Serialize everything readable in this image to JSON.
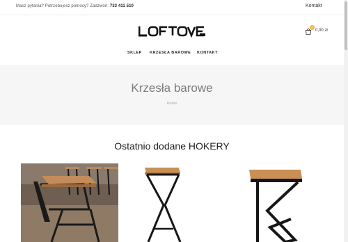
{
  "topbar": {
    "question": "Masz pytania? Potrzebujesz pomocy? Zadzwoń:",
    "phone": "733 411 510",
    "contact_link": "Kontakt"
  },
  "brand": {
    "logo_text": "LOFTOVE"
  },
  "cart": {
    "total": "0,00 zł",
    "count": "0"
  },
  "nav": {
    "items": [
      "SKLEP",
      "KRZESŁA BAROWE",
      "KONTAKT"
    ]
  },
  "hero": {
    "title": "Krzesła barowe",
    "breadcrumb": "Home"
  },
  "section": {
    "title": "Ostatnio dodane HOKERY"
  },
  "colors": {
    "accent": "#f0b23a",
    "hero_bg": "#f6f6f6",
    "steel": "#1a1a1a",
    "wood": "#c98f55"
  }
}
